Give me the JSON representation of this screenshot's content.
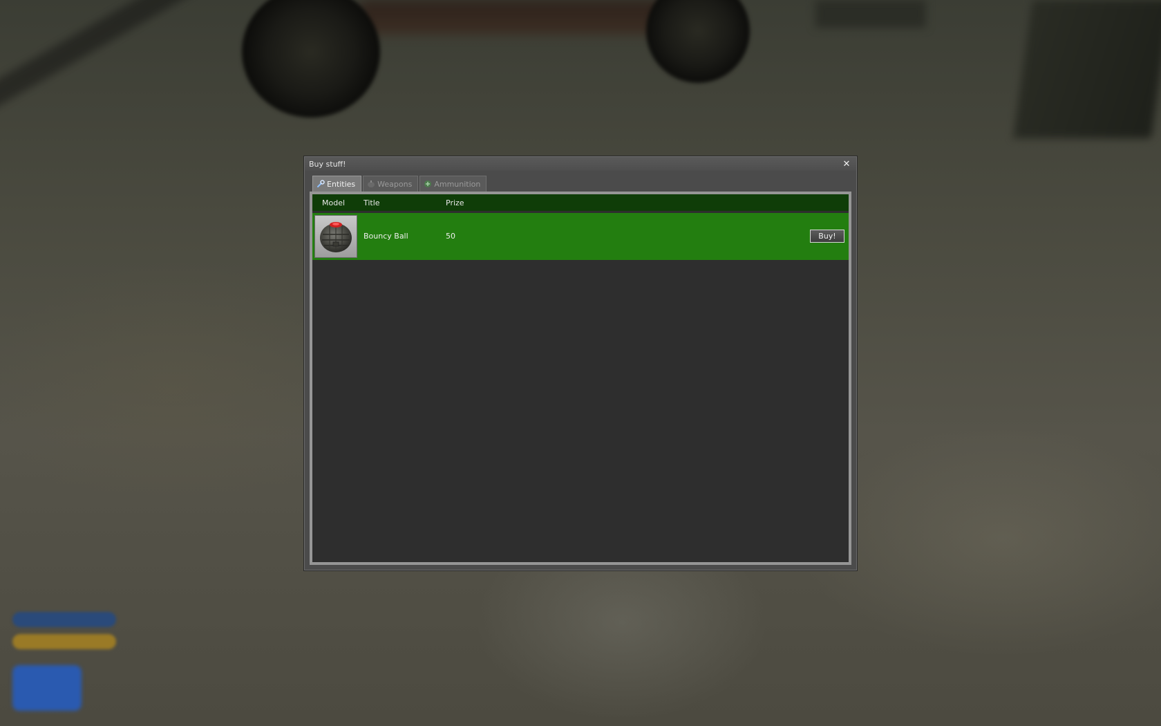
{
  "window": {
    "title": "Buy stuff!",
    "close_icon": "close-icon"
  },
  "tabs": [
    {
      "label": "Entities",
      "icon": "wrench-icon",
      "active": true
    },
    {
      "label": "Weapons",
      "icon": "grenade-icon",
      "active": false
    },
    {
      "label": "Ammunition",
      "icon": "plus-circle-icon",
      "active": false
    }
  ],
  "list": {
    "columns": {
      "model": "Model",
      "title": "Title",
      "prize": "Prize"
    },
    "rows": [
      {
        "model_icon": "combine-ball-icon",
        "title": "Bouncy Ball",
        "prize": "50",
        "buy_label": "Buy!"
      }
    ]
  },
  "colors": {
    "header_bg": "#0f3d08",
    "row_bg": "#237e10",
    "panel_bg": "#2e2e2e"
  }
}
